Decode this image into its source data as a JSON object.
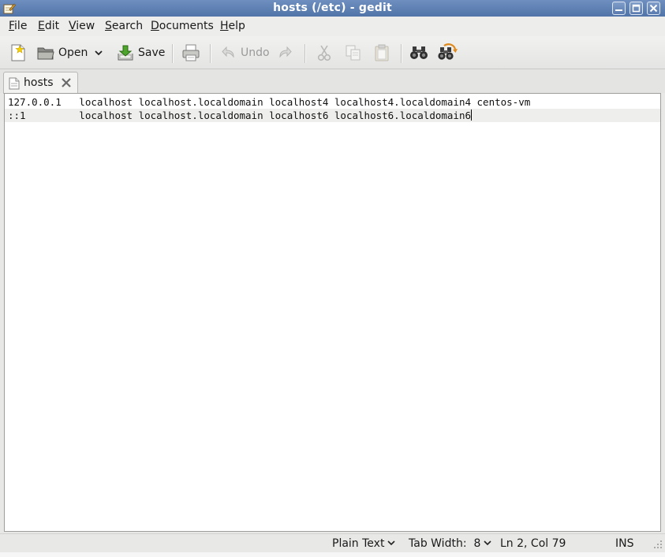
{
  "window": {
    "title": "hosts (/etc) - gedit",
    "app_icon": "gedit-notepad-icon",
    "controls": [
      "minimize-icon",
      "maximize-icon",
      "close-icon"
    ]
  },
  "menubar": {
    "items": [
      {
        "mnemonic": "F",
        "rest": "ile"
      },
      {
        "mnemonic": "E",
        "rest": "dit"
      },
      {
        "mnemonic": "V",
        "rest": "iew"
      },
      {
        "mnemonic": "S",
        "rest": "earch"
      },
      {
        "mnemonic": "D",
        "rest": "ocuments"
      },
      {
        "mnemonic": "H",
        "rest": "elp"
      }
    ]
  },
  "toolbar": {
    "new_icon": "new-document-icon",
    "open_label": "Open",
    "save_label": "Save",
    "undo_label": "Undo",
    "print_icon": "printer-icon",
    "redo_icon": "redo-icon",
    "cut_icon": "scissors-icon",
    "copy_icon": "copy-icon",
    "paste_icon": "paste-icon",
    "find_icon": "binoculars-icon",
    "replace_icon": "find-replace-icon"
  },
  "tabs": [
    {
      "label": "hosts",
      "active": true
    }
  ],
  "editor": {
    "lines": [
      "127.0.0.1   localhost localhost.localdomain localhost4 localhost4.localdomain4 centos-vm",
      "::1         localhost localhost.localdomain localhost6 localhost6.localdomain6"
    ],
    "current_line": 2
  },
  "statusbar": {
    "language": "Plain Text",
    "tab_width": "Tab Width:  8",
    "position": "Ln 2, Col 79",
    "mode": "INS"
  },
  "colors": {
    "titlebar": "#5a7bb0",
    "current_line_highlight": "#eeeeec",
    "background": "#e8e8e7"
  }
}
